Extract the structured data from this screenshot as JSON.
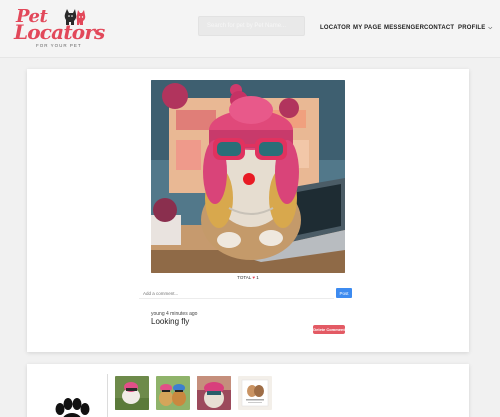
{
  "header": {
    "logo": {
      "title_line1": "Pet",
      "title_line2": "Locators",
      "tagline": "FOR YOUR PET"
    },
    "search": {
      "placeholder": "Search for pet by Pet Name..."
    },
    "nav": [
      {
        "label": "LOCATOR"
      },
      {
        "label": "MY PAGE"
      },
      {
        "label": "MESSENGER"
      },
      {
        "label": "CONTACT"
      },
      {
        "label": "PROFILE"
      }
    ]
  },
  "post": {
    "image_alt": "Dog wearing pink hat and sunglasses at a laptop",
    "likes_label": "TOTAL",
    "likes_count": "1",
    "comment_placeholder": "Add a comment...",
    "post_button": "Post",
    "comments": [
      {
        "author": "young",
        "time": "4 minutes ago",
        "text": "Looking fly"
      }
    ],
    "delete_button": "Delete Comment"
  },
  "profile": {
    "thumbnails": [
      {
        "name": "thumb-1"
      },
      {
        "name": "thumb-2"
      },
      {
        "name": "thumb-3"
      },
      {
        "name": "thumb-4"
      }
    ]
  },
  "colors": {
    "brand": "#e2485a",
    "post_button": "#3d8bf0",
    "delete_button": "#e35a64"
  }
}
